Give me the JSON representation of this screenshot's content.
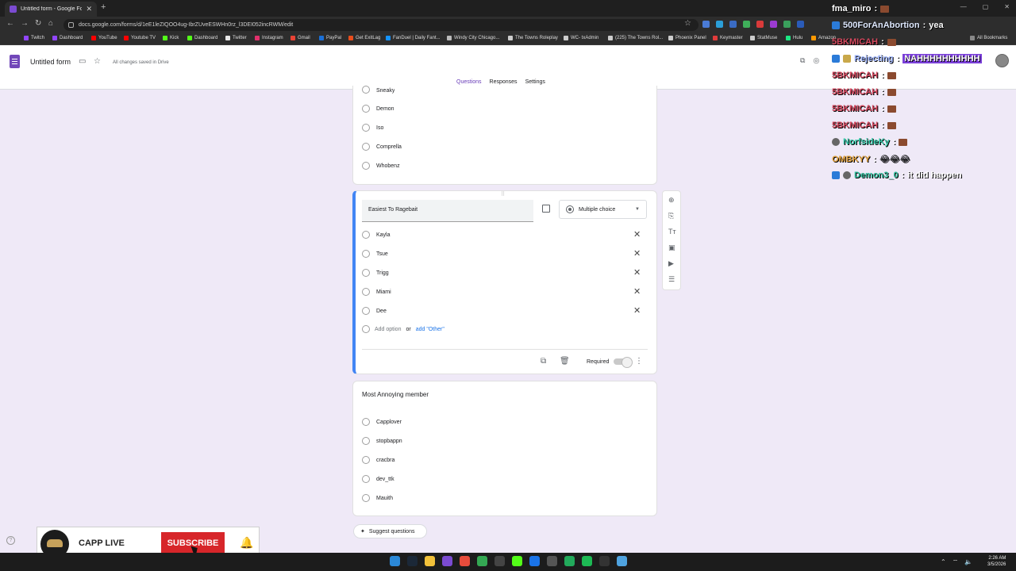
{
  "browser": {
    "tab_title": "Untitled form - Google Forms",
    "url": "docs.google.com/forms/d/1eE1leZIQOO4ug-IbrZUveESWHn0rz_l3DEI052incRWM/edit",
    "bookmarks": [
      "Twitch",
      "Dashboard",
      "YouTube",
      "Youtube TV",
      "Kick",
      "Dashboard",
      "Twitter",
      "Instagram",
      "Gmail",
      "PayPal",
      "Get ExitLag",
      "FanDuel | Daily Fant...",
      "Windy City Chicago...",
      "The Towns Roleplay",
      "WC- txAdmin",
      "(225) The Towns Rol...",
      "Phoenix Panel",
      "Keymaster",
      "StatMuse",
      "Hulu",
      "Amazon"
    ],
    "all_bookmarks": "All Bookmarks"
  },
  "forms": {
    "title": "Untitled form",
    "saved_status": "All changes saved in Drive",
    "tabs": [
      "Questions",
      "Responses",
      "Settings"
    ]
  },
  "card1": {
    "options": [
      "Sneaky",
      "Demon",
      "Iso",
      "Comprella",
      "Whobenz"
    ]
  },
  "card2": {
    "question": "Easiest To Ragebait",
    "type": "Multiple choice",
    "options": [
      "Kayla",
      "Tsue",
      "Trigg",
      "Miami",
      "Dee"
    ],
    "add_option": "Add option",
    "or": "or",
    "add_other": "add \"Other\"",
    "required": "Required"
  },
  "card3": {
    "question": "Most Annoying member",
    "options": [
      "Capplover",
      "stopbappn",
      "cracbra",
      "dev_ttk",
      "Mauith"
    ]
  },
  "suggest": "Suggest questions",
  "chat": [
    {
      "user": "fma_miro",
      "sep": " : ",
      "msg": "",
      "color": "#ffffff"
    },
    {
      "user": "500ForAnAbortion",
      "sep": " : ",
      "msg": "yea",
      "color": "#dfe9ff"
    },
    {
      "user": "5BKMICAH",
      "sep": " : ",
      "msg": "",
      "color": "#d84a60"
    },
    {
      "user": "Rejecting",
      "sep": " : ",
      "msg": "NAHHHHHHHHHH",
      "color": "#9fb6ff"
    },
    {
      "user": "5BKMICAH",
      "sep": " : ",
      "msg": "",
      "color": "#d84a60"
    },
    {
      "user": "5BKMICAH",
      "sep": " : ",
      "msg": "",
      "color": "#d84a60"
    },
    {
      "user": "5BKMICAH",
      "sep": " : ",
      "msg": "",
      "color": "#d84a60"
    },
    {
      "user": "5BKMICAH",
      "sep": " : ",
      "msg": "",
      "color": "#d84a60"
    },
    {
      "user": "NorfsideKy",
      "sep": " : ",
      "msg": "",
      "color": "#33c7a6"
    },
    {
      "user": "OMBKYY",
      "sep": " : ",
      "msg": "😂😂😂",
      "color": "#e2a23c"
    },
    {
      "user": "Demon3_0",
      "sep": " : ",
      "msg": "it did happen",
      "color": "#34c2a0"
    }
  ],
  "live": {
    "channel": "CAPP LIVE",
    "subscribe": "SUBSCRIBE"
  },
  "taskbar": {
    "time": "2:26 AM",
    "date": "3/5/2026"
  },
  "colors": {
    "accent": "#673ab7",
    "page_bg": "#efe9f7",
    "link": "#1a73e8",
    "subscribe_red": "#d7262a"
  }
}
